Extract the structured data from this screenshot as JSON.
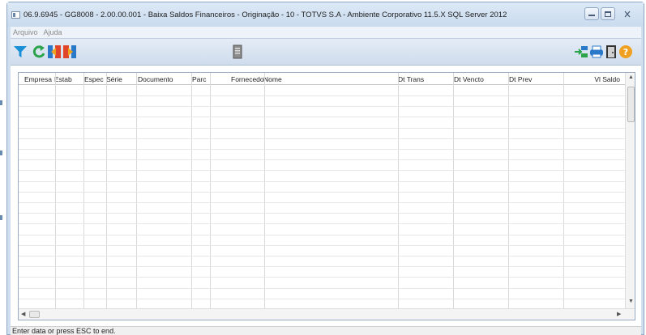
{
  "window": {
    "title": "06.9.6945 - GG8008 - 2.00.00.001 - Baixa Saldos Financeiros - Originação - 10 - TOTVS S.A - Ambiente Corporativo 11.5.X SQL Server 2012"
  },
  "menu": {
    "items": [
      {
        "label": "Arquivo"
      },
      {
        "label": "Ajuda"
      }
    ]
  },
  "toolbar": {
    "left_icons": [
      "filter-icon",
      "refresh-icon",
      "move-right-icon",
      "move-left-icon"
    ],
    "center_icons": [
      "document-icon"
    ],
    "right_icons": [
      "export-icon",
      "print-icon",
      "exit-door-icon",
      "help-icon"
    ],
    "colors": {
      "filter": "#1a8fd6",
      "refresh": "#2aa34a",
      "blue": "#2a78c8",
      "red": "#e0442b",
      "orange": "#f0a020"
    }
  },
  "grid": {
    "columns": [
      {
        "label": "Empresa"
      },
      {
        "label": "Estab"
      },
      {
        "label": "Espec"
      },
      {
        "label": "Série"
      },
      {
        "label": "Documento"
      },
      {
        "label": "Parc"
      },
      {
        "label": "Fornecedor"
      },
      {
        "label": "Nome"
      },
      {
        "label": "Dt Trans"
      },
      {
        "label": "Dt Vencto"
      },
      {
        "label": "Dt Prev"
      },
      {
        "label": "Vl Saldo"
      }
    ],
    "rows": []
  },
  "status": {
    "text": "Enter data or press ESC to end."
  }
}
